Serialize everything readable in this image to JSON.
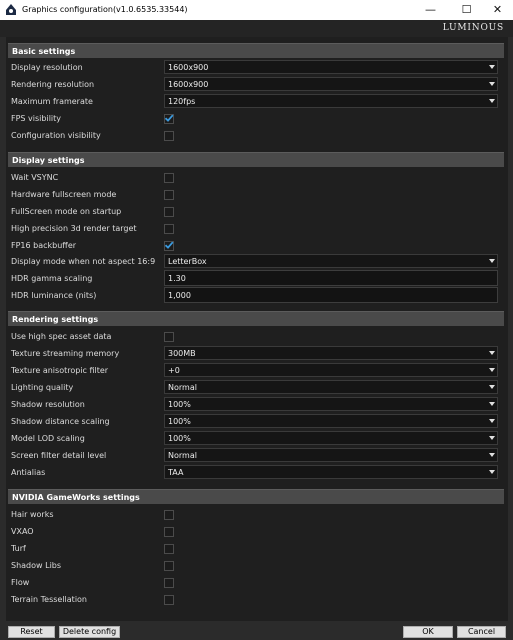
{
  "window": {
    "title": "Graphics configuration(v1.0.6535.33544)",
    "brand": "LUMINOUS",
    "minimize_glyph": "—",
    "maximize_glyph": "☐",
    "close_glyph": "✕",
    "icon": "app-icon"
  },
  "colors": {
    "check": "#3b9be0",
    "section_header_bg": "#4a4a4a",
    "panel_bg": "#1f1f1f"
  },
  "sections": {
    "basic": {
      "title": "Basic settings",
      "display_resolution": {
        "label": "Display resolution",
        "value": "1600x900"
      },
      "rendering_resolution": {
        "label": "Rendering resolution",
        "value": "1600x900"
      },
      "maximum_framerate": {
        "label": "Maximum framerate",
        "value": "120fps"
      },
      "fps_visibility": {
        "label": "FPS visibility",
        "checked": true
      },
      "configuration_visibility": {
        "label": "Configuration visibility",
        "checked": false
      }
    },
    "display": {
      "title": "Display settings",
      "wait_vsync": {
        "label": "Wait VSYNC",
        "checked": false
      },
      "hardware_fullscreen": {
        "label": "Hardware fullscreen mode",
        "checked": false
      },
      "fullscreen_on_startup": {
        "label": "FullScreen mode on startup",
        "checked": false
      },
      "high_precision_target": {
        "label": "High precision 3d render target",
        "checked": false
      },
      "fp16_backbuffer": {
        "label": "FP16 backbuffer",
        "checked": true
      },
      "display_mode_aspect": {
        "label": "Display mode when not aspect 16:9",
        "value": "LetterBox"
      },
      "hdr_gamma": {
        "label": "HDR gamma scaling",
        "value": "1.30"
      },
      "hdr_luminance": {
        "label": "HDR luminance (nits)",
        "value": "1,000"
      }
    },
    "rendering": {
      "title": "Rendering settings",
      "high_spec_assets": {
        "label": "Use high spec asset data",
        "checked": false
      },
      "texture_streaming": {
        "label": "Texture streaming memory",
        "value": "300MB"
      },
      "texture_aniso": {
        "label": "Texture anisotropic filter",
        "value": "+0"
      },
      "lighting_quality": {
        "label": "Lighting quality",
        "value": "Normal"
      },
      "shadow_resolution": {
        "label": "Shadow resolution",
        "value": "100%"
      },
      "shadow_distance": {
        "label": "Shadow distance scaling",
        "value": "100%"
      },
      "model_lod": {
        "label": "Model LOD scaling",
        "value": "100%"
      },
      "screen_filter": {
        "label": "Screen filter detail level",
        "value": "Normal"
      },
      "antialias": {
        "label": "Antialias",
        "value": "TAA"
      }
    },
    "gameworks": {
      "title": "NVIDIA GameWorks settings",
      "hair_works": {
        "label": "Hair works",
        "checked": false
      },
      "vxao": {
        "label": "VXAO",
        "checked": false
      },
      "turf": {
        "label": "Turf",
        "checked": false
      },
      "shadow_libs": {
        "label": "Shadow Libs",
        "checked": false
      },
      "flow": {
        "label": "Flow",
        "checked": false
      },
      "terrain_tessellation": {
        "label": "Terrain Tessellation",
        "checked": false
      }
    }
  },
  "footer": {
    "reset": "Reset",
    "delete_config": "Delete config",
    "ok": "OK",
    "cancel": "Cancel"
  }
}
